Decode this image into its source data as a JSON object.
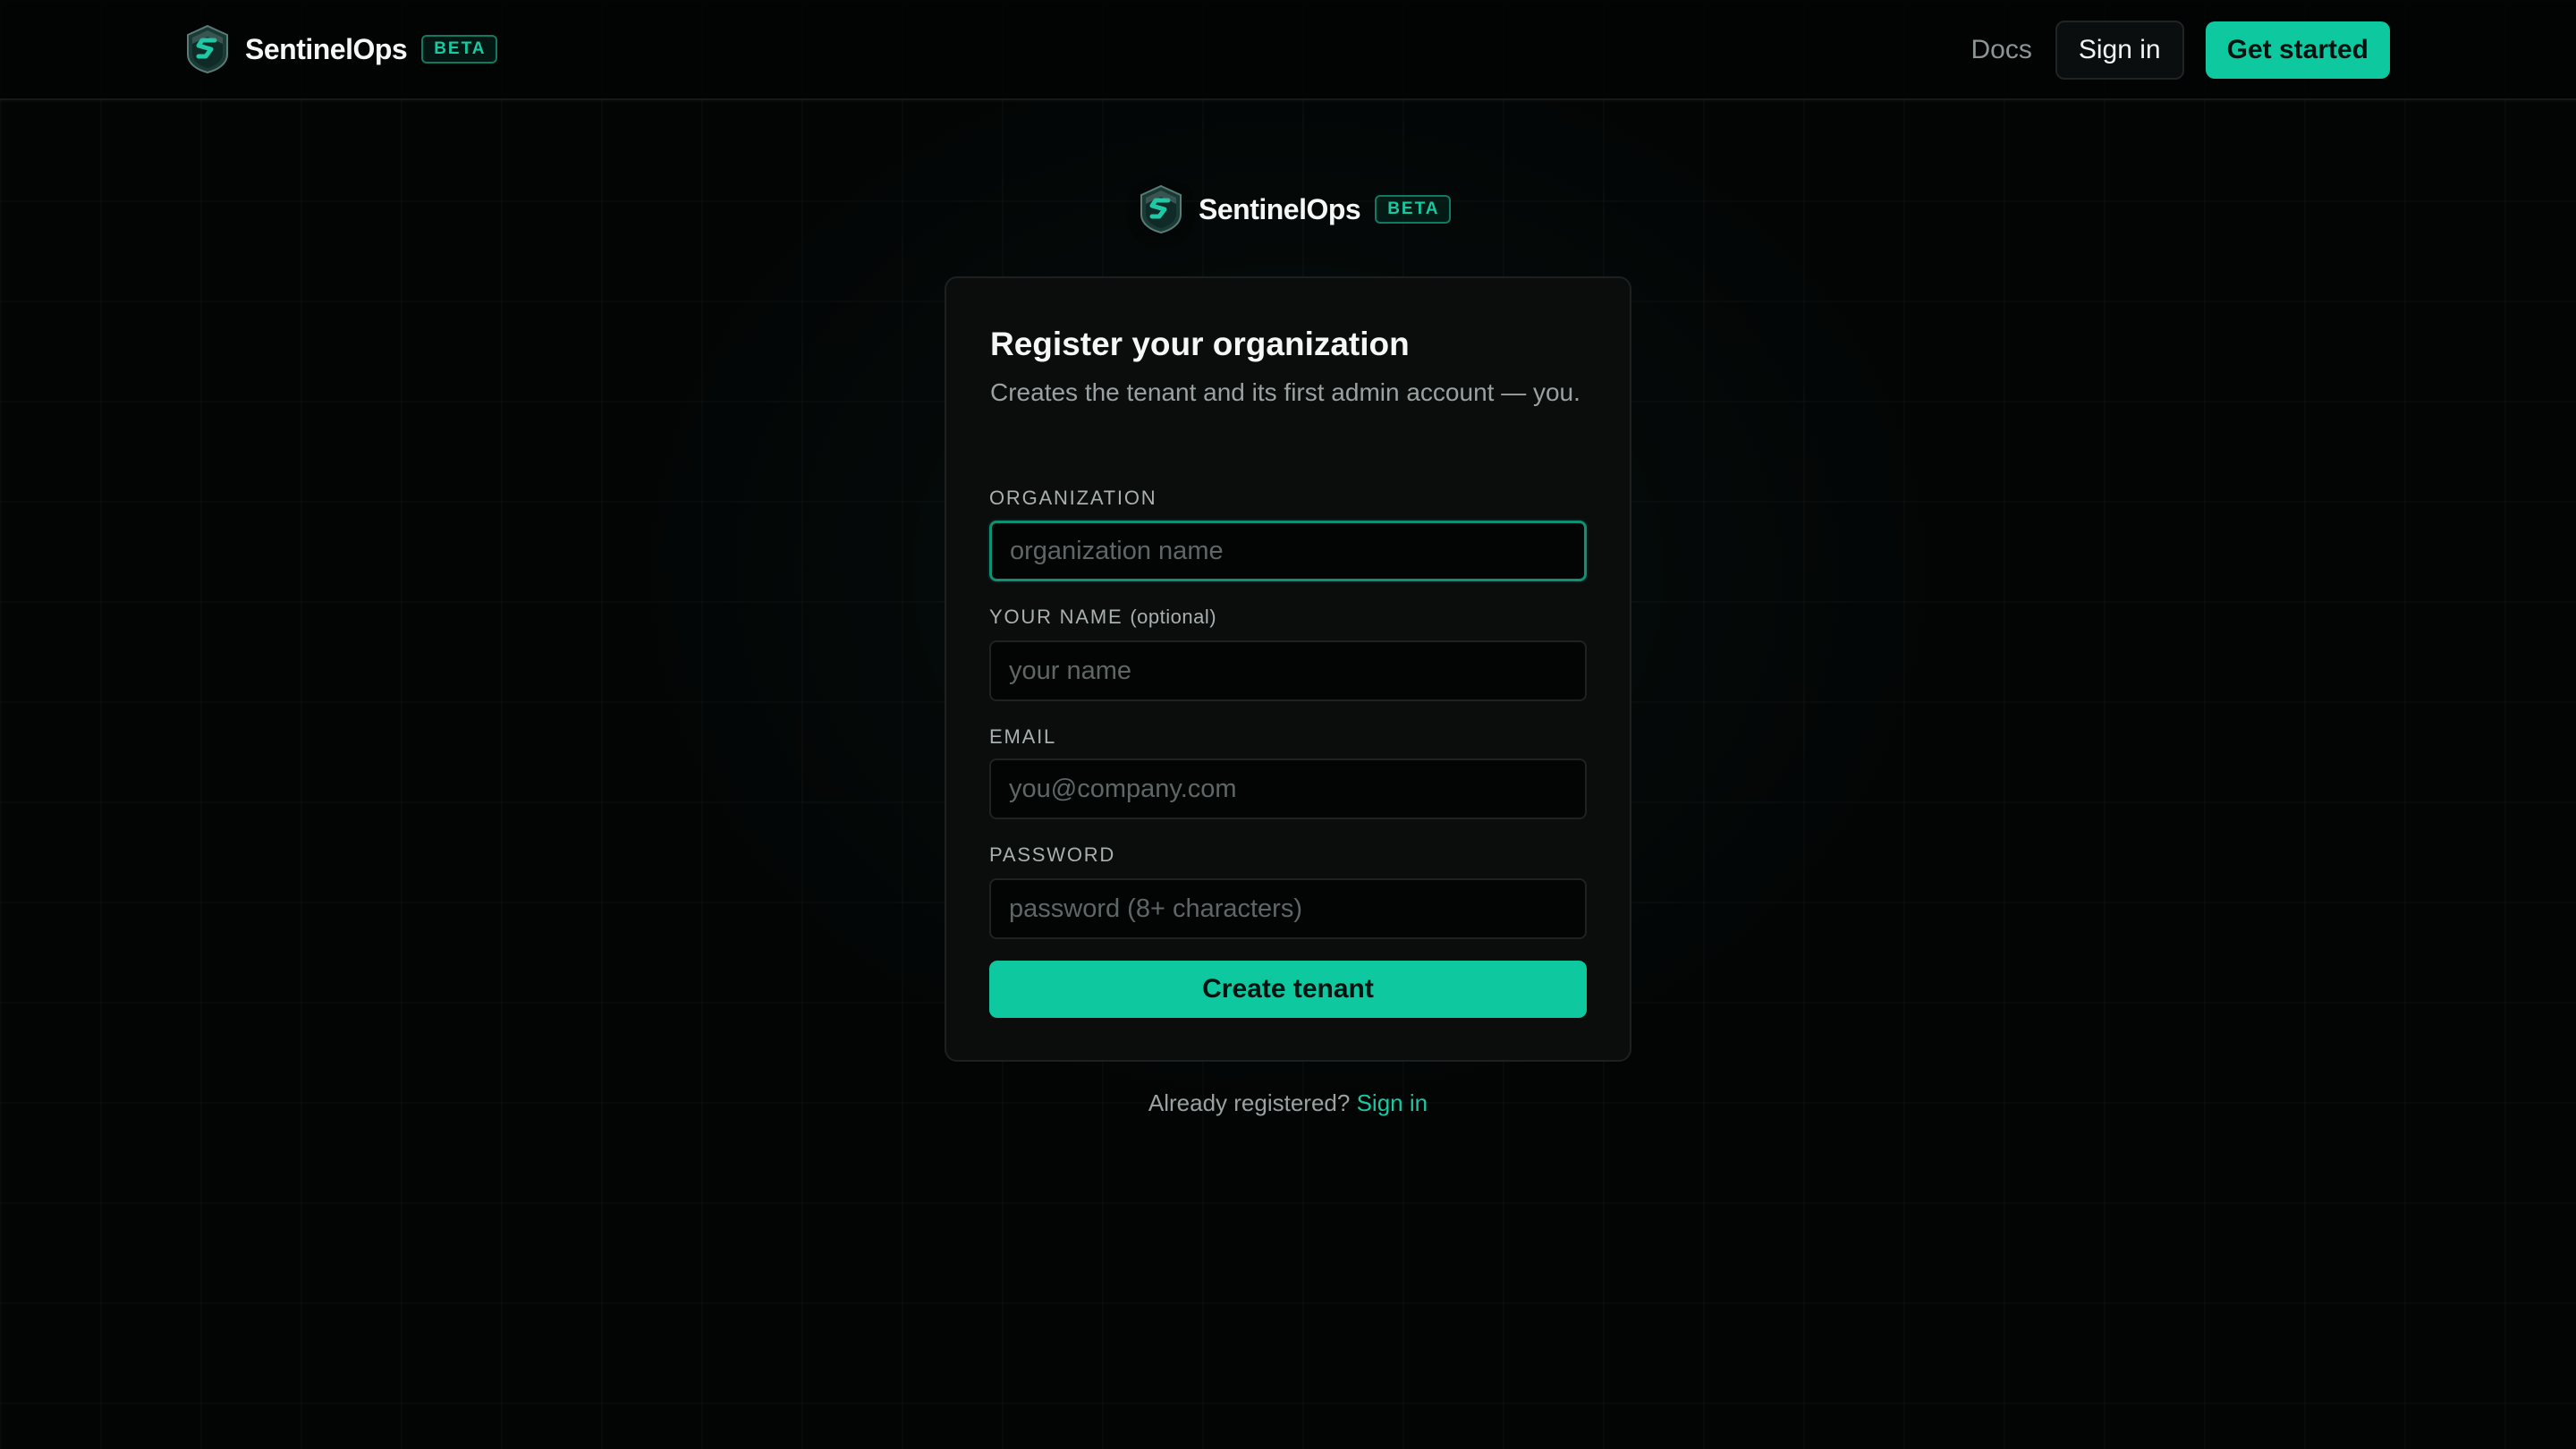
{
  "header": {
    "brand_name": "SentinelOps",
    "beta_badge": "BETA",
    "nav": {
      "docs": "Docs",
      "sign_in": "Sign in",
      "get_started": "Get started"
    }
  },
  "center_brand": {
    "brand_name": "SentinelOps",
    "beta_badge": "BETA"
  },
  "form": {
    "title": "Register your organization",
    "subtitle": "Creates the tenant and its first admin account — you.",
    "fields": [
      {
        "label": "ORGANIZATION",
        "label_suffix": "",
        "placeholder": "organization name",
        "value": "",
        "focused": true
      },
      {
        "label": "YOUR NAME",
        "label_suffix": "(optional)",
        "placeholder": "your name",
        "value": "",
        "focused": false
      },
      {
        "label": "EMAIL",
        "label_suffix": "",
        "placeholder": "you@company.com",
        "value": "",
        "focused": false
      },
      {
        "label": "PASSWORD",
        "label_suffix": "",
        "placeholder": "password (8+ characters)",
        "value": "",
        "focused": false
      }
    ],
    "submit_label": "Create tenant"
  },
  "footer": {
    "prompt": "Already registered?",
    "link": "Sign in"
  },
  "colors": {
    "accent": "#0ec9a0",
    "background": "#030404",
    "card": "#0b0c0c"
  },
  "icons": {
    "logo": "shield-s-logo-icon"
  }
}
